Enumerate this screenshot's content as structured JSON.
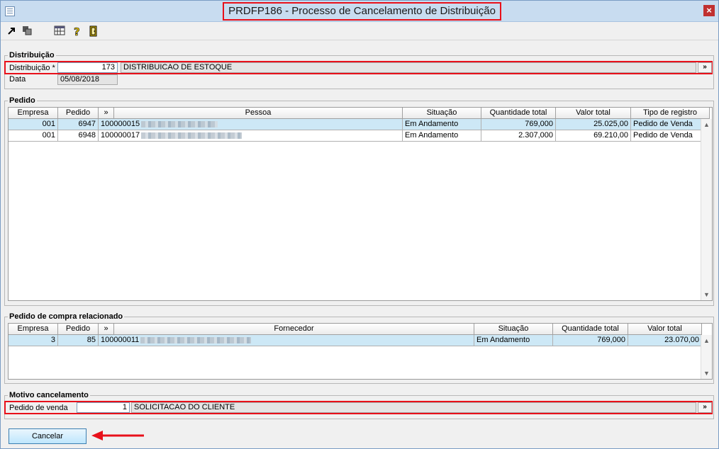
{
  "window": {
    "title": "PRDFP186 - Processo de Cancelamento de Distribuição",
    "close_icon": "close-icon"
  },
  "toolbar": {
    "icons": [
      "export-icon",
      "copy-icon",
      "calendar-grid-icon",
      "help-icon",
      "exit-door-icon"
    ]
  },
  "distribuicao": {
    "group_label": "Distribuição",
    "field_label": "Distribuição *",
    "code": "173",
    "description": "DISTRIBUICAO DE ESTOQUE",
    "lookup": "»",
    "date_label": "Data",
    "date": "05/08/2018"
  },
  "pedido": {
    "group_label": "Pedido",
    "columns": [
      "Empresa",
      "Pedido",
      "»",
      "Pessoa",
      "Situação",
      "Quantidade total",
      "Valor total",
      "Tipo de registro"
    ],
    "rows": [
      {
        "empresa": "001",
        "pedido": "6947",
        "codigo": "100000015",
        "situacao": "Em Andamento",
        "quantidade": "769,000",
        "valor": "25.025,00",
        "tipo": "Pedido de Venda"
      },
      {
        "empresa": "001",
        "pedido": "6948",
        "codigo": "100000017",
        "situacao": "Em Andamento",
        "quantidade": "2.307,000",
        "valor": "69.210,00",
        "tipo": "Pedido de Venda"
      }
    ]
  },
  "compra": {
    "group_label": "Pedido de compra relacionado",
    "columns": [
      "Empresa",
      "Pedido",
      "»",
      "Fornecedor",
      "Situação",
      "Quantidade total",
      "Valor total"
    ],
    "rows": [
      {
        "empresa": "3",
        "pedido": "85",
        "codigo": "100000011",
        "situacao": "Em Andamento",
        "quantidade": "769,000",
        "valor": "23.070,00"
      }
    ]
  },
  "motivo": {
    "group_label": "Motivo cancelamento",
    "field_label": "Pedido de venda",
    "code": "1",
    "description": "SOLICITACAO DO CLIENTE",
    "lookup": "»"
  },
  "actions": {
    "cancel_label": "Cancelar"
  },
  "colors": {
    "highlight": "#e8101a",
    "selected_row": "#cde8f6",
    "titlebar": "#c8dcf0"
  }
}
